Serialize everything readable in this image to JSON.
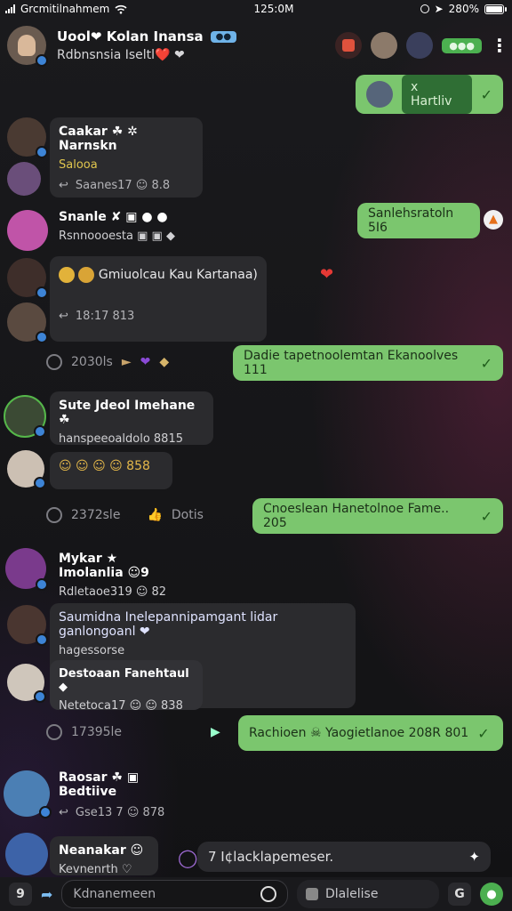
{
  "status_bar": {
    "carrier": "Grcmitilnahmem",
    "time": "125:0M",
    "battery": "280%"
  },
  "header": {
    "name": "Uool❤ Kolan Inansa",
    "sub": "Rdbnsnsia Iseltl❤️ ❤",
    "tag": "",
    "online_label": "●●●",
    "avatar_color": "#6a5b50"
  },
  "colors": {
    "outgoing": "#7bc66e",
    "incoming": "#2b2b2e",
    "verified": "#3d84d6",
    "accent_red": "#e53935"
  },
  "messages": [
    {
      "type": "out",
      "text": "x Hartliv",
      "has_avatar": true
    },
    {
      "type": "in",
      "sender": "Caakar ☘ ✲ Narnskn",
      "line": "Salooa",
      "meta": "Saanes17 ☺ 8.8"
    },
    {
      "type": "out",
      "text": "Sanlehsratoln 5I6"
    },
    {
      "type": "in",
      "sender": "Snanle ✘ ▣ ● ●",
      "line": "Rsnnoooesta ▣ ▣ ◆"
    },
    {
      "type": "in",
      "sender": "",
      "line": "Gmiuolcau Kau Kartanaa)",
      "meta": "18:17 813"
    },
    {
      "type": "sys",
      "text": "2030ls"
    },
    {
      "type": "out",
      "text": "Dadie tapetnoolemtan Ekanoolves 111"
    },
    {
      "type": "in",
      "sender": "Sute Jdeol Imehane ☘",
      "line": "hanspeeoaldolo 8815"
    },
    {
      "type": "in",
      "sender": "",
      "line": "☺ ☺ ☺ ☺ 858"
    },
    {
      "type": "sys",
      "text": "2372sle"
    },
    {
      "type": "out",
      "text": "Cnoeslean Hanetolnoe Fame.. 205"
    },
    {
      "type": "in",
      "sender": "Mykar ★ Imolanlia ☺9",
      "line": "Rdletaoe319 ☺ 82"
    },
    {
      "type": "in",
      "sender": "Saumidna Inelepannipamgant lidar ganlongoanl ❤",
      "line": "hagessorse"
    },
    {
      "type": "in",
      "sender": "Destoaan Fanehtaul ◆",
      "line": "Netetoca17 ☺ ☺ 838"
    },
    {
      "type": "sys",
      "text": "17395le"
    },
    {
      "type": "out",
      "text": "Rachioen ☠ Yaogietlanoe 208R 801"
    },
    {
      "type": "in",
      "sender": "Raosar ☘ ▣ Bedtiive",
      "line": "Gse13 7 ☺ 878"
    },
    {
      "type": "in",
      "sender": "Neanakar ☺",
      "line": "Kevnenrth ♡"
    }
  ],
  "composer": {
    "prompt_text": "7 I¢lacklapemeser.",
    "input_placeholder": "Kdnanemeen",
    "secondary_label": "Dlalelise"
  }
}
